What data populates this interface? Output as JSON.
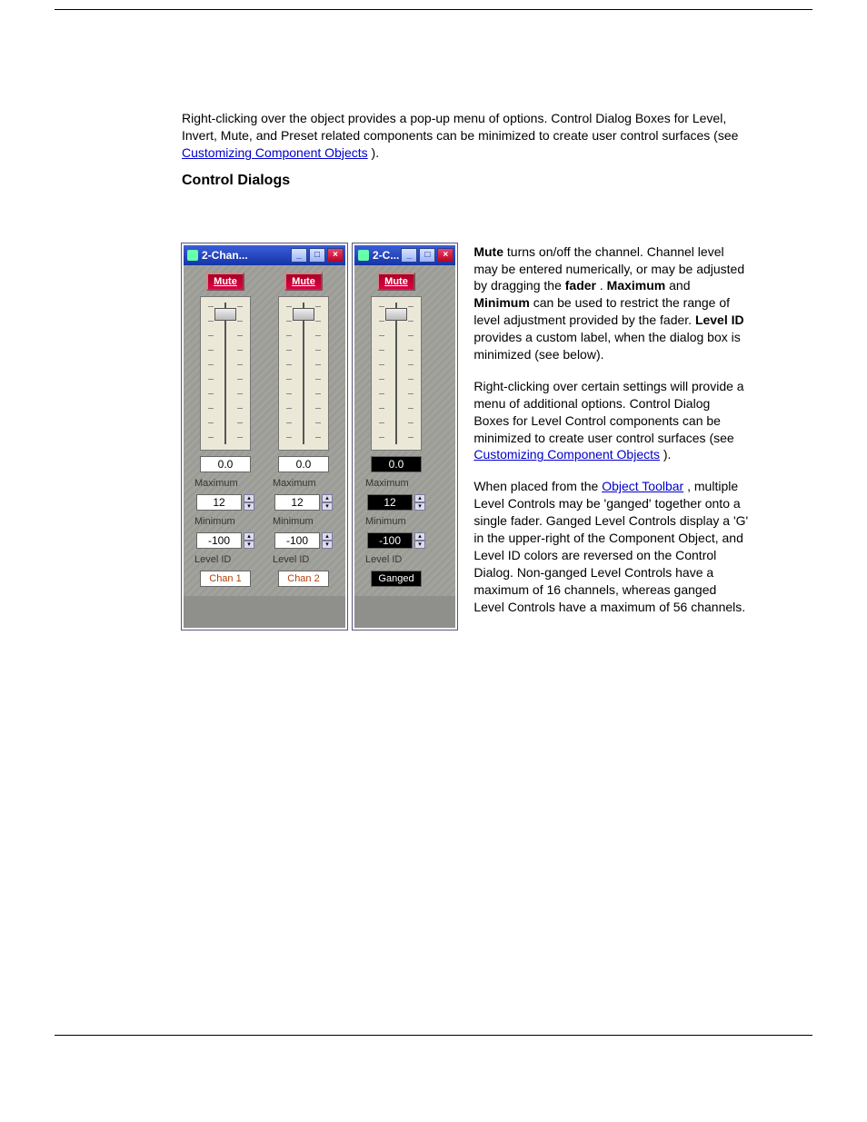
{
  "intro": {
    "p1_a": "Right-clicking over the object provides a pop-up menu of options. Control Dialog Boxes for Level, Invert, Mute, and Preset related components can be minimized to create user control surfaces (see ",
    "link1": "Customizing Component Objects",
    "p1_b": ")."
  },
  "heading": "Control Dialogs",
  "dialogs": [
    {
      "title": "2-Chan...",
      "channels": [
        {
          "mute": "Mute",
          "level": "0.0",
          "max_label": "Maximum",
          "max": "12",
          "min_label": "Minimum",
          "min": "-100",
          "id_label": "Level ID",
          "id": "Chan 1",
          "dark": false
        },
        {
          "mute": "Mute",
          "level": "0.0",
          "max_label": "Maximum",
          "max": "12",
          "min_label": "Minimum",
          "min": "-100",
          "id_label": "Level ID",
          "id": "Chan 2",
          "dark": false
        }
      ]
    },
    {
      "title": "2-C...",
      "channels": [
        {
          "mute": "Mute",
          "level": "0.0",
          "max_label": "Maximum",
          "max": "12",
          "min_label": "Minimum",
          "min": "-100",
          "id_label": "Level ID",
          "id": "Ganged",
          "dark": true
        }
      ]
    }
  ],
  "right": {
    "p1_pre": "",
    "p1_bold1": "Mute",
    "p1_a": " turns on/off the channel. Channel level may be entered numerically, or may be adjusted by dragging the ",
    "p1_bold2": "fader",
    "p1_b": ". ",
    "p1_bold3": "Maximum",
    "p1_c": " and ",
    "p1_bold4": "Minimum",
    "p1_d": " can be used to restrict the range of level adjustment provided by the fader. ",
    "p1_bold5": "Level ID",
    "p1_e": " provides a custom label, when the dialog box is minimized (see below).",
    "p2_a": "Right-clicking over certain settings will provide a menu of additional options. Control Dialog Boxes for Level Control components can be minimized to create user control surfaces (see ",
    "p2_link": "Customizing Component Objects",
    "p2_b": ").",
    "p3_a": "When placed from the ",
    "p3_link": "Object Toolbar",
    "p3_b": ", multiple Level Controls may be 'ganged' together onto a single fader. Ganged Level Controls display a 'G' in the upper-right of the Component Object, and Level ID colors are reversed on the Control Dialog. Non-ganged Level Controls have a maximum of 16 channels, whereas ganged Level Controls have a maximum of 56 channels."
  }
}
